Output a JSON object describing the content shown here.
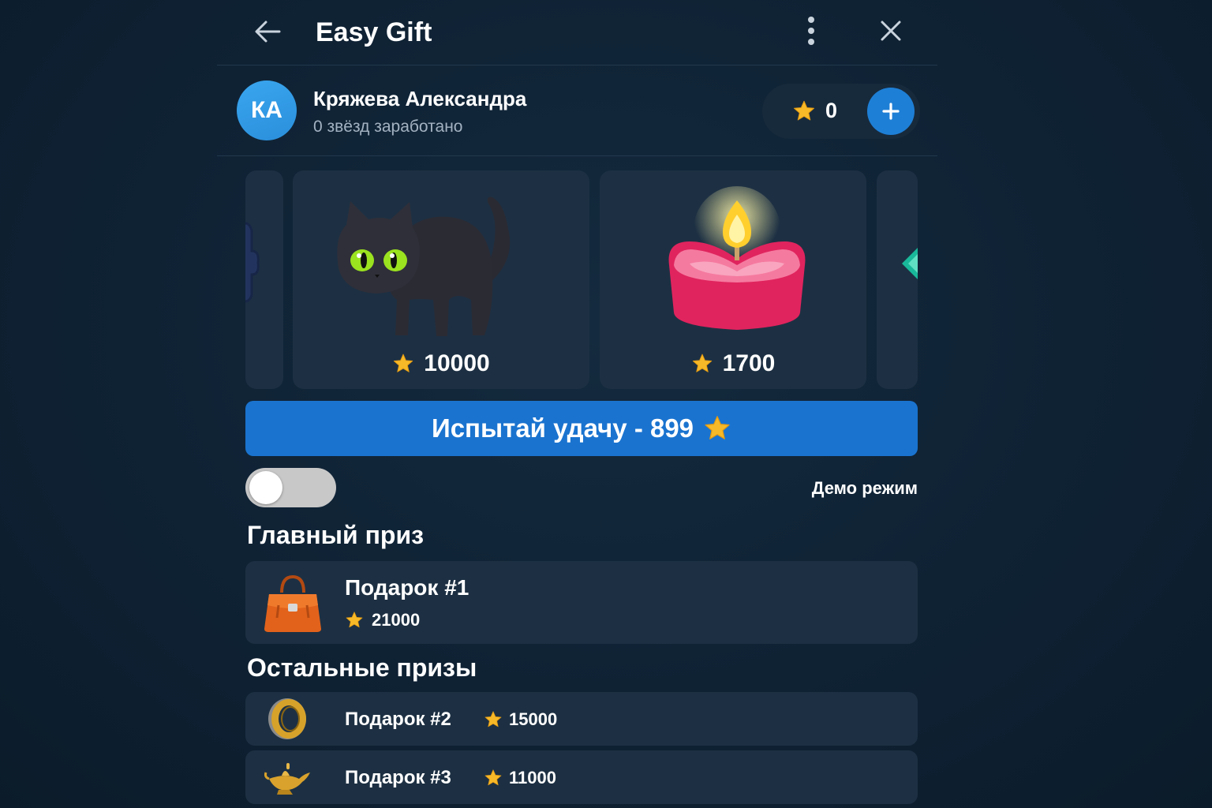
{
  "header": {
    "title": "Easy Gift"
  },
  "user": {
    "initials": "КА",
    "name": "Кряжева Александра",
    "subtitle": "0 звёзд заработано",
    "balance": "0"
  },
  "carousel": {
    "items": [
      {
        "icon": "black-cat-icon",
        "price": "10000"
      },
      {
        "icon": "heart-candle-icon",
        "price": "1700"
      }
    ]
  },
  "luck_button": {
    "label": "Испытай удачу - 899"
  },
  "demo": {
    "label": "Демо режим",
    "enabled": false
  },
  "main_prize": {
    "section_title": "Главный приз",
    "name": "Подарок #1",
    "price": "21000",
    "icon": "handbag-icon"
  },
  "other_prizes": {
    "section_title": "Остальные призы",
    "items": [
      {
        "name": "Подарок #2",
        "price": "15000",
        "icon": "ring-icon"
      },
      {
        "name": "Подарок #3",
        "price": "11000",
        "icon": "magic-lamp-icon"
      }
    ]
  },
  "colors": {
    "background": "#0f2234",
    "card": "#1d3043",
    "accent": "#1a73cf",
    "star": "#f7b928"
  }
}
